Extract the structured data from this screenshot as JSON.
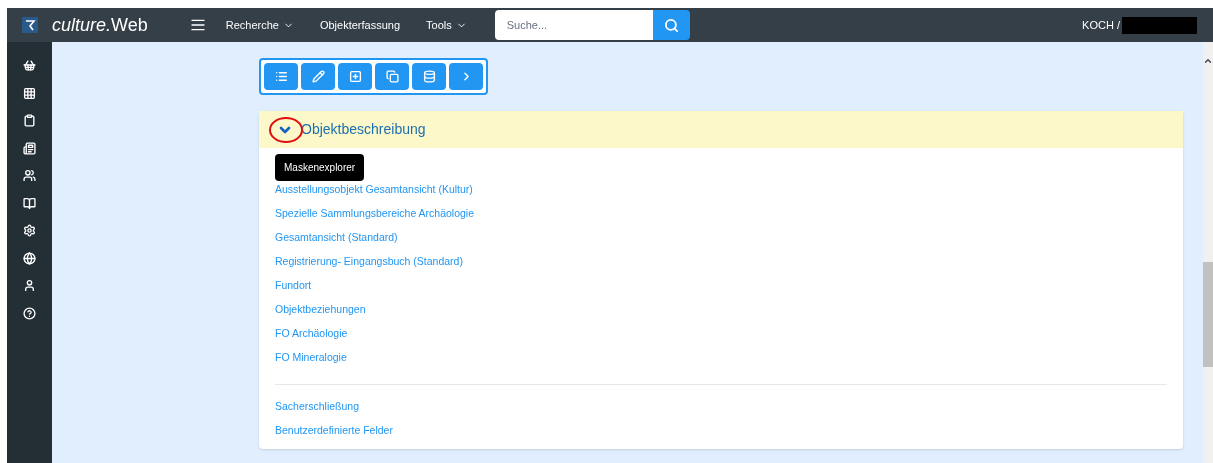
{
  "header": {
    "brand_prefix": "culture.",
    "brand_suffix": "Web",
    "nav": [
      {
        "label": "Recherche",
        "dropdown": true
      },
      {
        "label": "Objekterfassung",
        "dropdown": false
      },
      {
        "label": "Tools",
        "dropdown": true
      }
    ],
    "search": {
      "placeholder": "Suche..."
    },
    "user": "KOCH /"
  },
  "section": {
    "title": "Objektbeschreibung",
    "expanded": true,
    "tooltip": "Maskenexplorer",
    "groups": [
      [
        "Ausstellungsobjekt Gesamtansicht (Kultur)",
        "Spezielle Sammlungsbereiche Archäologie",
        "Gesamtansicht (Standard)",
        "Registrierung- Eingangsbuch (Standard)",
        "Fundort",
        "Objektbeziehungen",
        "FO Archäologie",
        "FO Mineralogie"
      ],
      [
        "Sacherschließung",
        "Benutzerdefinierte Felder"
      ]
    ]
  }
}
